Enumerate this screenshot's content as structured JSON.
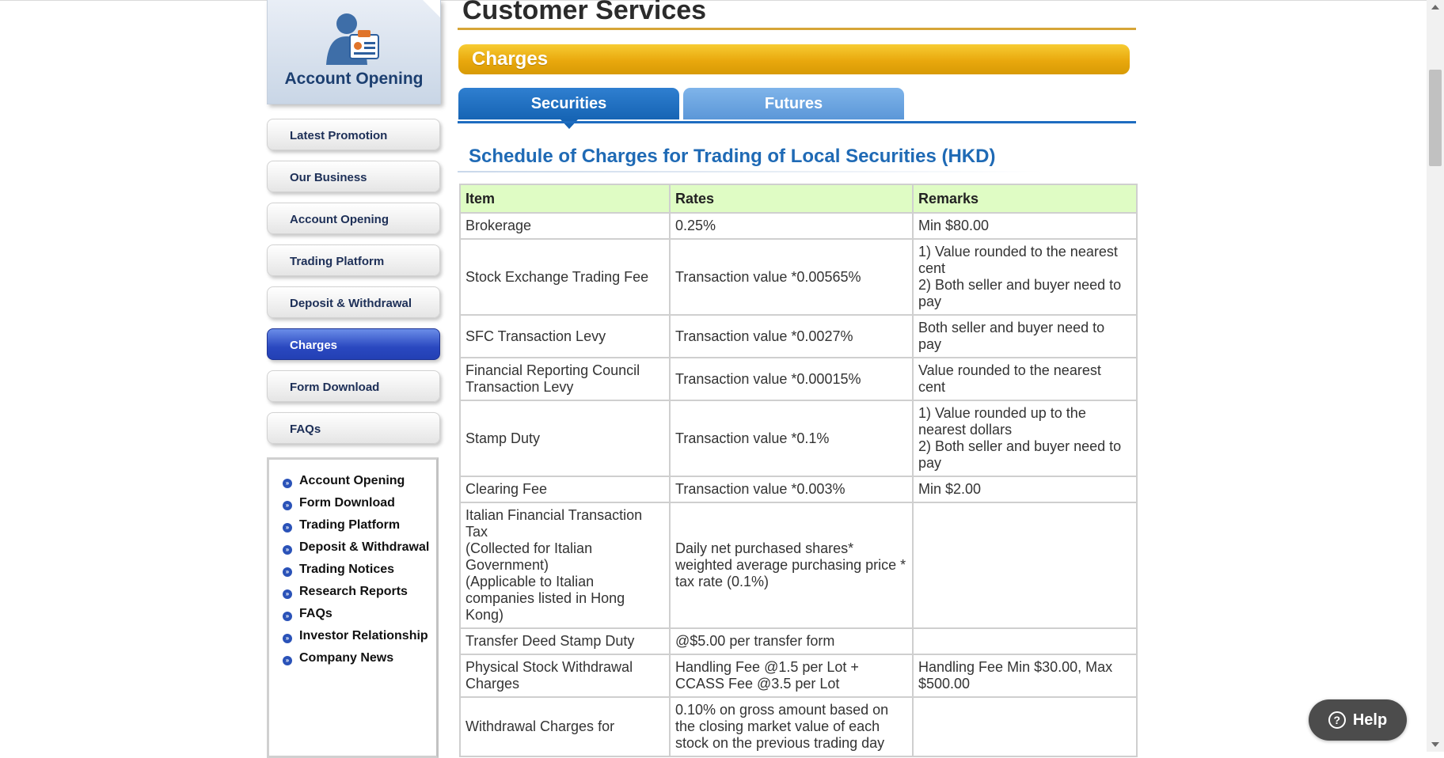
{
  "sidebar": {
    "hero_title": "Account Opening",
    "nav": [
      {
        "label": "Latest Promotion",
        "active": false
      },
      {
        "label": "Our Business",
        "active": false
      },
      {
        "label": "Account Opening",
        "active": false
      },
      {
        "label": "Trading Platform",
        "active": false
      },
      {
        "label": "Deposit & Withdrawal",
        "active": false
      },
      {
        "label": "Charges",
        "active": true
      },
      {
        "label": "Form Download",
        "active": false
      },
      {
        "label": "FAQs",
        "active": false
      }
    ],
    "links": [
      "Account Opening",
      "Form Download",
      "Trading Platform",
      "Deposit & Withdrawal",
      "Trading Notices",
      "Research Reports",
      "FAQs",
      "Investor Relationship",
      "Company News"
    ]
  },
  "main": {
    "page_title": "Customer Services",
    "section_title": "Charges",
    "tabs": [
      {
        "label": "Securities",
        "active": true
      },
      {
        "label": "Futures",
        "active": false
      }
    ],
    "schedule_title": "Schedule of Charges for Trading of Local Securities (HKD)",
    "table": {
      "headers": [
        "Item",
        "Rates",
        "Remarks"
      ],
      "rows": [
        {
          "item": [
            "Brokerage"
          ],
          "rates": [
            "0.25%"
          ],
          "remarks": [
            "Min $80.00"
          ]
        },
        {
          "item": [
            "Stock Exchange Trading Fee"
          ],
          "rates": [
            "Transaction value *0.00565%"
          ],
          "remarks": [
            "1) Value rounded to the nearest cent",
            "2) Both seller and buyer need to pay"
          ]
        },
        {
          "item": [
            "SFC Transaction Levy"
          ],
          "rates": [
            "Transaction value *0.0027%"
          ],
          "remarks": [
            "Both seller and buyer need to pay"
          ]
        },
        {
          "item": [
            "Financial Reporting Council Transaction Levy"
          ],
          "rates": [
            "Transaction value *0.00015%"
          ],
          "remarks": [
            "Value rounded to the nearest cent"
          ]
        },
        {
          "item": [
            "Stamp Duty"
          ],
          "rates": [
            "Transaction value *0.1%"
          ],
          "remarks": [
            "1) Value rounded up to the nearest dollars",
            "2) Both seller and buyer need to pay"
          ]
        },
        {
          "item": [
            "Clearing Fee"
          ],
          "rates": [
            "Transaction value *0.003%"
          ],
          "remarks": [
            "Min $2.00"
          ]
        },
        {
          "item": [
            "Italian Financial Transaction Tax",
            "(Collected for Italian Government)",
            "(Applicable to Italian companies listed in Hong Kong)"
          ],
          "rates": [
            "Daily net purchased shares* weighted average purchasing price * tax rate (0.1%)"
          ],
          "remarks": []
        },
        {
          "item": [
            "Transfer Deed Stamp Duty"
          ],
          "rates": [
            "@$5.00 per transfer form"
          ],
          "remarks": []
        },
        {
          "item": [
            "Physical Stock Withdrawal Charges"
          ],
          "rates": [
            "Handling Fee @1.5 per Lot + CCASS Fee @3.5 per Lot"
          ],
          "remarks": [
            "Handling Fee Min $30.00, Max $500.00"
          ]
        },
        {
          "item": [
            "Withdrawal Charges for"
          ],
          "rates": [
            "0.10% on gross amount based on the closing market value of each stock on the previous trading day"
          ],
          "remarks": []
        }
      ]
    }
  },
  "help": {
    "label": "Help"
  },
  "colors": {
    "accent_blue": "#1f6ab5",
    "gold": "#e9a80d",
    "header_green": "#dffcc4",
    "nav_active": "#2a48c0"
  }
}
